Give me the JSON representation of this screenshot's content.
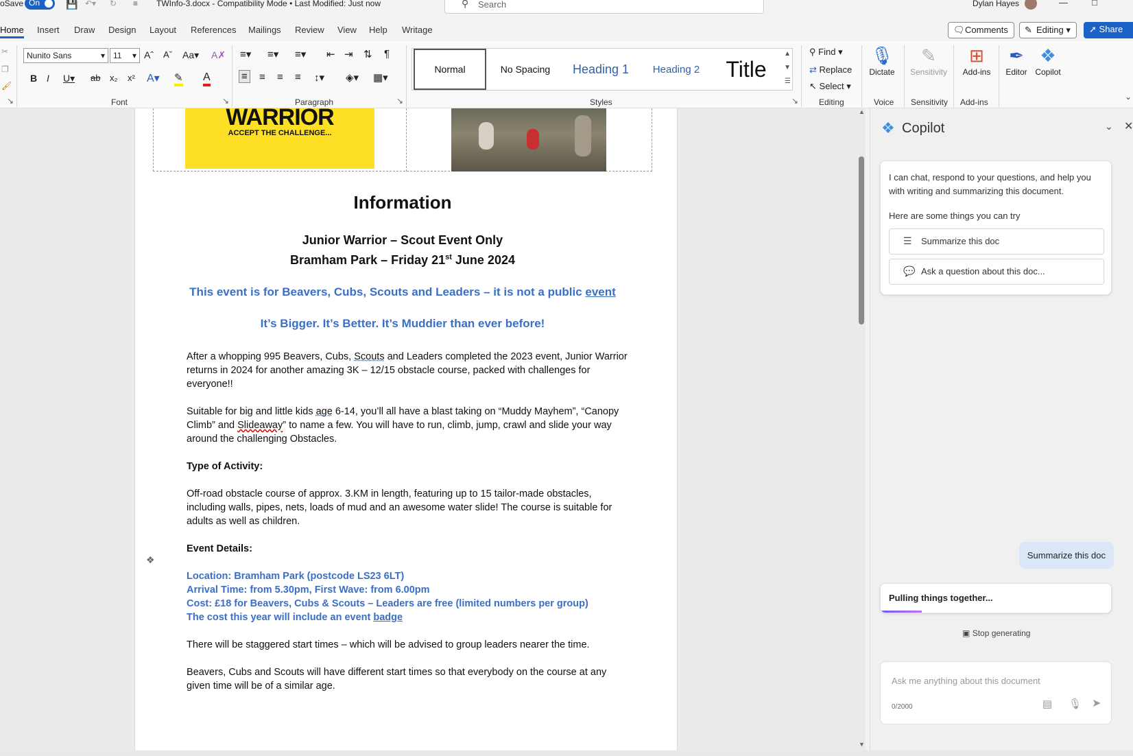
{
  "titlebar": {
    "autosave_label": "oSave",
    "autosave_state": "On",
    "doc_title": "TWInfo-3.docx  -  Compatibility Mode  •  Last Modified: Just now",
    "search_placeholder": "Search",
    "user_name": "Dylan Hayes"
  },
  "tabs": [
    "Home",
    "Insert",
    "Draw",
    "Design",
    "Layout",
    "References",
    "Mailings",
    "Review",
    "View",
    "Help",
    "Writage"
  ],
  "actions": {
    "comments": "Comments",
    "editing": "Editing",
    "share": "Share"
  },
  "ribbon": {
    "font_name": "Nunito Sans",
    "font_size": "11",
    "font_label": "Font",
    "paragraph_label": "Paragraph",
    "styles_label": "Styles",
    "editing_label": "Editing",
    "voice_label": "Voice",
    "sensitivity_label": "Sensitivity",
    "addins_label": "Add-ins",
    "styles": [
      "Normal",
      "No Spacing",
      "Heading 1",
      "Heading 2",
      "Title"
    ],
    "find": "Find",
    "replace": "Replace",
    "select": "Select",
    "dictate": "Dictate",
    "sensitivity": "Sensitivity",
    "addins": "Add-ins",
    "editor": "Editor",
    "copilot": "Copilot"
  },
  "document": {
    "logo_word": "WARRIOR",
    "logo_tag": "ACCEPT THE CHALLENGE...",
    "heading": "Information",
    "subheading_1": "Junior Warrior – Scout Event Only",
    "subheading_2a": "Bramham Park – Friday 21",
    "subheading_2_sup": "st",
    "subheading_2b": " June 2024",
    "notice_a": "This event is for Beavers, Cubs, Scouts and Leaders – it is not a public ",
    "notice_b": "event",
    "tagline": "It’s Bigger.  It’s Better.  It’s Muddier than ever before!",
    "para1a": "After a whopping 995 Beavers, Cubs, ",
    "para1b": "Scouts",
    "para1c": " and Leaders completed the 2023 event, Junior Warrior returns in 2024 for another amazing 3K – 12/15 obstacle course, packed with challenges for everyone!!",
    "para2a": "Suitable for big and little kids ",
    "para2b": "age",
    "para2c": " 6-14, you’ll all have a blast taking on “Muddy Mayhem”, “Canopy Climb” and ",
    "para2d": "Slideaway",
    "para2e": "” to name a few.  You will have to run, climb, jump, crawl and slide your way around the challenging Obstacles.",
    "type_heading": "Type of Activity:",
    "para3": "Off-road obstacle course of approx. 3.KM in length, featuring up to 15 tailor-made obstacles, including walls, pipes, nets, loads of mud and an awesome water slide!   The course is suitable for adults as well as children.",
    "details_heading": "Event Details:",
    "location": "Location: Bramham Park (postcode LS23 6LT)",
    "arrival": "Arrival Time: from 5.30pm, First Wave:  from 6.00pm",
    "cost": "Cost:  £18 for Beavers, Cubs & Scouts – Leaders are free (limited numbers per group)",
    "badge_a": "The cost this year will include an event ",
    "badge_b": "badge",
    "para4": "There will be staggered start times – which will be advised to group leaders nearer the time.",
    "para5": "Beavers, Cubs and Scouts will have different start times so that everybody on the course at any given time will be of a similar age."
  },
  "copilot": {
    "title": "Copilot",
    "intro": "I can chat, respond to your questions, and help you with writing and summarizing this document.",
    "try_label": "Here are some things you can try",
    "suggestions": [
      "Summarize this doc",
      "Ask a question about this doc..."
    ],
    "user_message": "Summarize this doc",
    "status": "Pulling things together...",
    "stop": "Stop generating",
    "input_placeholder": "Ask me anything about this document",
    "char_count": "0/2000"
  }
}
